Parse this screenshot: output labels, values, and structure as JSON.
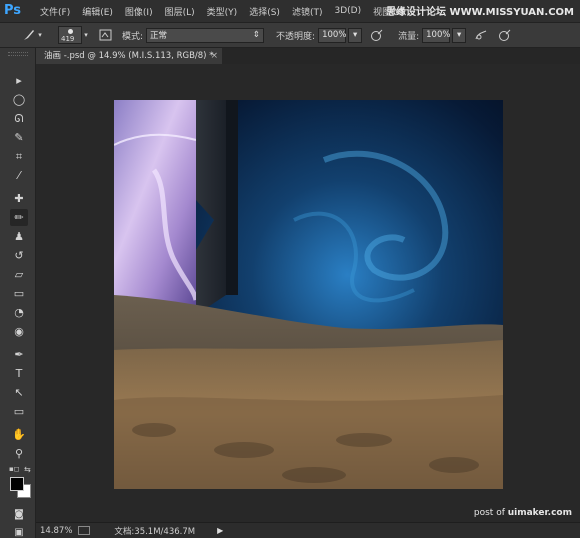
{
  "app": {
    "logo": "Ps"
  },
  "menu": {
    "items": [
      {
        "label": "文件(F)"
      },
      {
        "label": "编辑(E)"
      },
      {
        "label": "图像(I)"
      },
      {
        "label": "图层(L)"
      },
      {
        "label": "类型(Y)"
      },
      {
        "label": "选择(S)"
      },
      {
        "label": "滤镜(T)"
      },
      {
        "label": "3D(D)"
      },
      {
        "label": "视图(V)"
      }
    ]
  },
  "watermark_top": "思缘设计论坛 WWW.MISSYUAN.COM",
  "options": {
    "brush_size": "419",
    "mode_label": "模式:",
    "mode_value": "正常",
    "opacity_label": "不透明度:",
    "opacity_value": "100%",
    "flow_label": "流量:",
    "flow_value": "100%"
  },
  "document": {
    "tab_title": "油画 -.psd @ 14.9% (M.I.S.113, RGB/8) *",
    "tab_close": "×"
  },
  "status": {
    "zoom": "14.87%",
    "doc_size": "文档:35.1M/436.7M",
    "arrow": "▶"
  },
  "credit": {
    "prefix": "post of ",
    "site": "uimaker.com"
  },
  "toolbox": {
    "tools": [
      {
        "name": "move-tool-icon",
        "glyph": "▸"
      },
      {
        "name": "marquee-tool-icon",
        "glyph": "◯"
      },
      {
        "name": "lasso-tool-icon",
        "glyph": "ᘏ"
      },
      {
        "name": "quick-select-tool-icon",
        "glyph": "✎"
      },
      {
        "name": "crop-tool-icon",
        "glyph": "⌗"
      },
      {
        "name": "eyedropper-tool-icon",
        "glyph": "⁄"
      },
      {
        "name": "healing-tool-icon",
        "glyph": "✚"
      },
      {
        "name": "brush-tool-icon",
        "glyph": "✏"
      },
      {
        "name": "clone-stamp-tool-icon",
        "glyph": "♟"
      },
      {
        "name": "history-brush-tool-icon",
        "glyph": "↺"
      },
      {
        "name": "eraser-tool-icon",
        "glyph": "▱"
      },
      {
        "name": "gradient-tool-icon",
        "glyph": "▭"
      },
      {
        "name": "blur-tool-icon",
        "glyph": "◔"
      },
      {
        "name": "dodge-tool-icon",
        "glyph": "◉"
      },
      {
        "name": "pen-tool-icon",
        "glyph": "✒"
      },
      {
        "name": "type-tool-icon",
        "glyph": "T"
      },
      {
        "name": "path-select-tool-icon",
        "glyph": "↖"
      },
      {
        "name": "shape-tool-icon",
        "glyph": "▭"
      },
      {
        "name": "hand-tool-icon",
        "glyph": "✋"
      },
      {
        "name": "zoom-tool-icon",
        "glyph": "⚲"
      }
    ],
    "active_index": 7
  }
}
